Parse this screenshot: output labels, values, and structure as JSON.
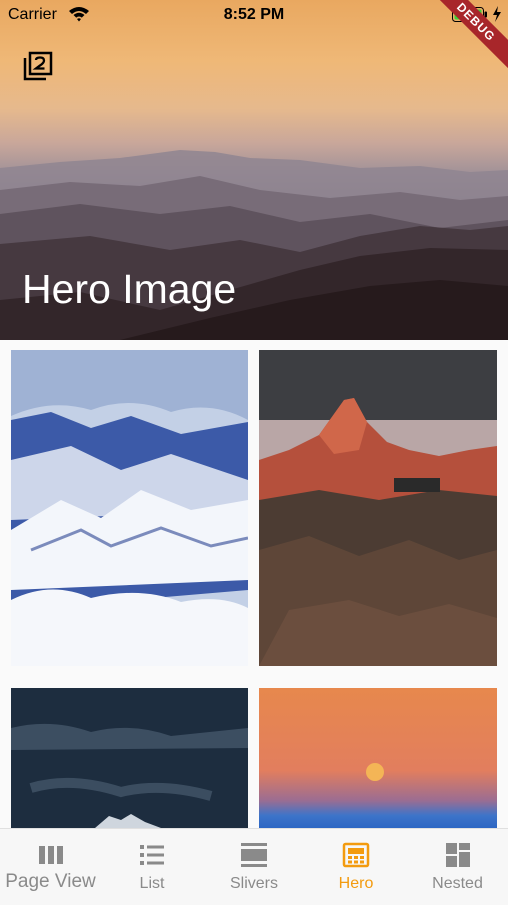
{
  "status_bar": {
    "carrier": "Carrier",
    "time": "8:52 PM"
  },
  "debug_banner": "DEBUG",
  "hero": {
    "title": "Hero Image",
    "filter_icon": "filter-2-icon"
  },
  "grid": {
    "images": [
      {
        "name": "snowy-mountains"
      },
      {
        "name": "red-peak-rocky"
      },
      {
        "name": "dark-sky-mountain"
      },
      {
        "name": "orange-sky-moon"
      }
    ]
  },
  "bottom_nav": {
    "active_color": "#f39b0f",
    "inactive_color": "#8a8a8a",
    "items": [
      {
        "label": "Page View",
        "icon": "columns-icon"
      },
      {
        "label": "List",
        "icon": "list-icon"
      },
      {
        "label": "Slivers",
        "icon": "rows-icon"
      },
      {
        "label": "Hero",
        "icon": "hero-icon",
        "active": true
      },
      {
        "label": "Nested",
        "icon": "dashboard-icon"
      }
    ]
  }
}
